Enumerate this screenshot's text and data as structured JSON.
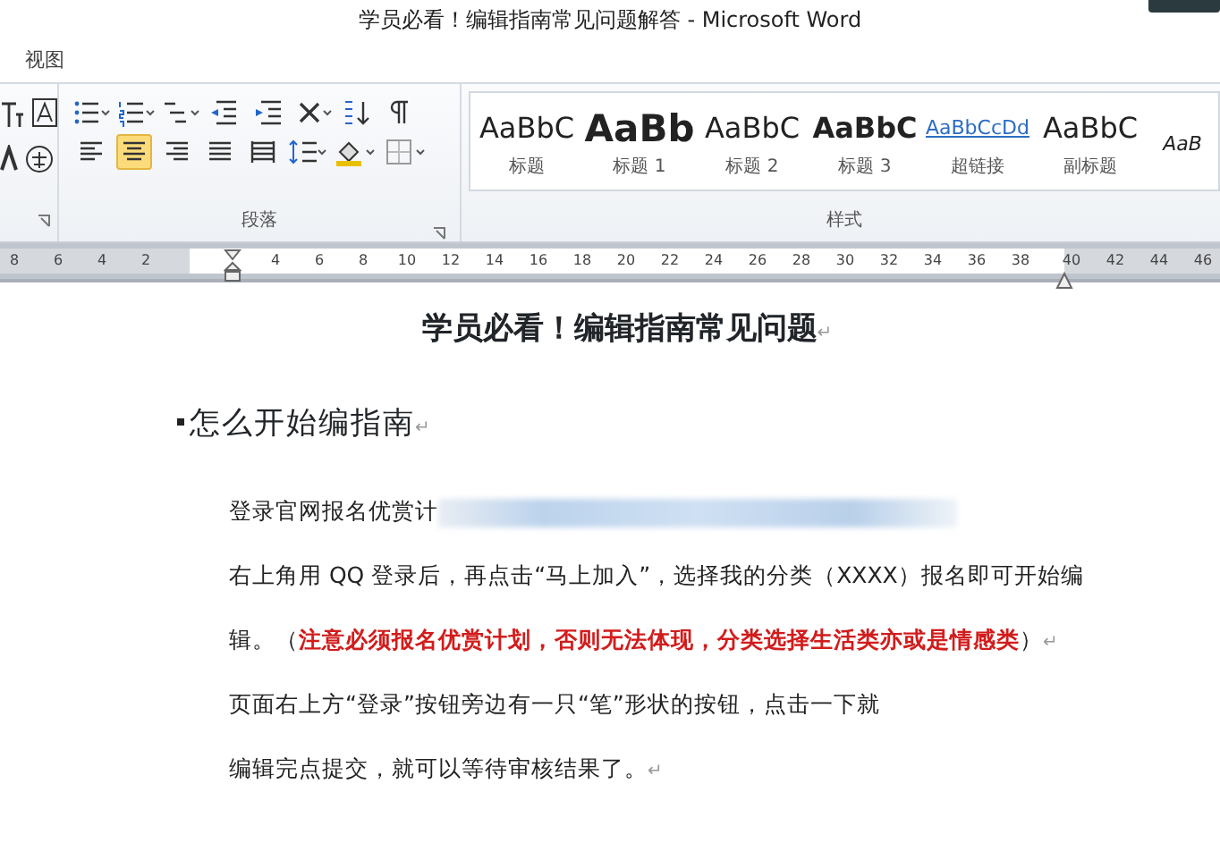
{
  "window": {
    "title": "学员必看！编辑指南常见问题解答 - Microsoft Word"
  },
  "ribbon_tabs": [
    {
      "label": "视图"
    }
  ],
  "ribbon": {
    "groups": [
      {
        "label": "段落"
      },
      {
        "label": "样式"
      }
    ],
    "align_buttons": [
      {
        "kind": "left",
        "selected": false
      },
      {
        "kind": "center",
        "selected": true
      },
      {
        "kind": "right",
        "selected": false
      },
      {
        "kind": "justify",
        "selected": false
      },
      {
        "kind": "distributed",
        "selected": false
      }
    ],
    "styles": [
      {
        "sample": "AaBbC",
        "label": "标题",
        "kind": "plain"
      },
      {
        "sample": "AaBb",
        "label": "标题 1",
        "kind": "heavy"
      },
      {
        "sample": "AaBbC",
        "label": "标题 2",
        "kind": "plain"
      },
      {
        "sample": "AaBbC",
        "label": "标题 3",
        "kind": "bold"
      },
      {
        "sample": "AaBbCcDd",
        "label": "超链接",
        "kind": "link"
      },
      {
        "sample": "AaBbC",
        "label": "副标题",
        "kind": "plain"
      },
      {
        "sample": "AaB",
        "kind": "italic"
      }
    ]
  },
  "ruler": {
    "left_numbers": [
      "8",
      "6",
      "4",
      "2"
    ],
    "text_numbers": [
      "4",
      "6",
      "8",
      "10",
      "12",
      "14",
      "16",
      "18",
      "20",
      "22",
      "24",
      "26",
      "28",
      "30",
      "32",
      "34",
      "36",
      "38"
    ],
    "right_numbers": [
      "40",
      "42",
      "44",
      "46"
    ]
  },
  "document": {
    "title": "学员必看！编辑指南常见问题",
    "title_mark": "↵",
    "sections": [
      {
        "heading": "怎么开始编指南",
        "heading_mark": "↵",
        "lines": [
          [
            {
              "kind": "normal",
              "text": "登录官网报名优赏计"
            },
            {
              "kind": "blur"
            }
          ],
          [
            {
              "kind": "normal",
              "text": "右上角用 QQ 登录后，再点击“马上加入”，选择我的分类（XXXX）报名即可开始编"
            }
          ],
          [
            {
              "kind": "normal",
              "text": "辑。（"
            },
            {
              "kind": "warning",
              "text": "注意必须报名优赏计划，否则无法体现，分类选择生活类亦或是情感类"
            },
            {
              "kind": "normal",
              "text": "）"
            },
            {
              "kind": "mark",
              "text": "↵"
            }
          ],
          [
            {
              "kind": "normal",
              "text": "页面右上方“登录”按钮旁边有一只“笔”形状的按钮，点击一下就"
            }
          ],
          [
            {
              "kind": "normal",
              "text": "编辑完点提交，就可以等待审核结果了。"
            },
            {
              "kind": "mark",
              "text": "↵"
            }
          ]
        ]
      }
    ]
  }
}
